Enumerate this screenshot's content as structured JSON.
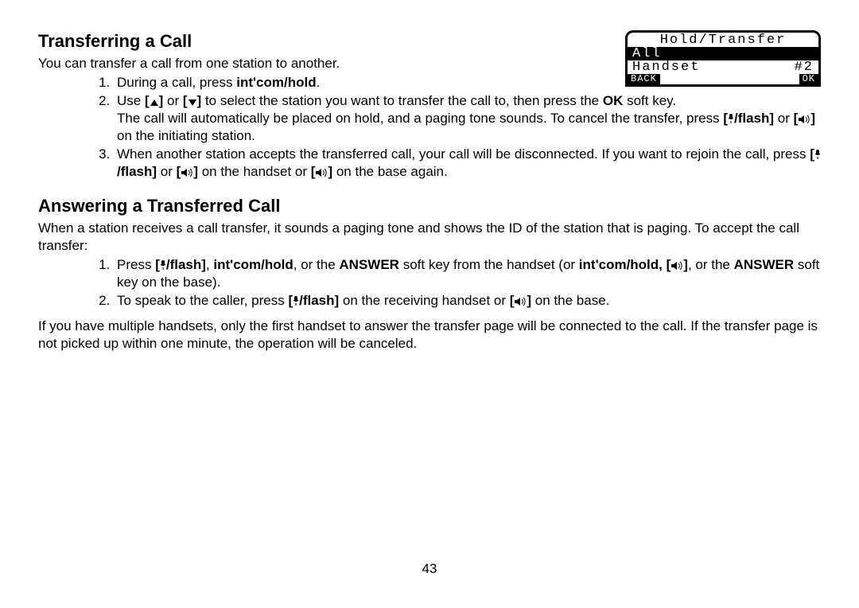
{
  "section1": {
    "heading": "Transferring a Call",
    "intro": "You can transfer a call from one station to another.",
    "step1_a": "During a call, press ",
    "step1_b": "int'com/hold",
    "step1_c": ".",
    "step2_a": "Use ",
    "step2_b": " or ",
    "step2_c": " to select the station you want to transfer the call to, then press the ",
    "step2_d": "OK",
    "step2_e": " soft key.",
    "step2_f": "The call will automatically be placed on hold, and a paging tone sounds. To cancel the transfer, press ",
    "step2_g": " or ",
    "step2_h": " on the initiating station.",
    "step3_a": "When another station accepts the transferred call, your call will be disconnected. If you want to rejoin the call, press ",
    "step3_b": " or ",
    "step3_c": " on the handset or ",
    "step3_d": " on the base again.",
    "flash": "/flash"
  },
  "lcd": {
    "title": "Hold/Transfer",
    "line2": "All",
    "line3a": "Handset",
    "line3b": "#2",
    "back": "BACK",
    "ok": "OK"
  },
  "section2": {
    "heading": "Answering a Transferred Call",
    "intro": "When a station receives a call transfer, it sounds a paging tone and shows the ID of the station that is paging. To accept the call transfer:",
    "step1_a": "Press ",
    "step1_b": ", ",
    "step1_c": "int'com/hold",
    "step1_d": ", or the ",
    "step1_e": "ANSWER",
    "step1_f": " soft key from the handset (or ",
    "step1_g": "int'com/hold, ",
    "step1_h": ", or the ",
    "step1_i": "ANSWER",
    "step1_j": " soft key on the base).",
    "step2_a": "To speak to the caller, press ",
    "step2_b": " on the receiving handset or ",
    "step2_c": " on the base.",
    "outro": "If you have multiple handsets, only the first handset to answer the transfer page will be connected to the call. If the transfer page is not picked up within one minute, the operation will be canceled."
  },
  "pagenum": "43"
}
